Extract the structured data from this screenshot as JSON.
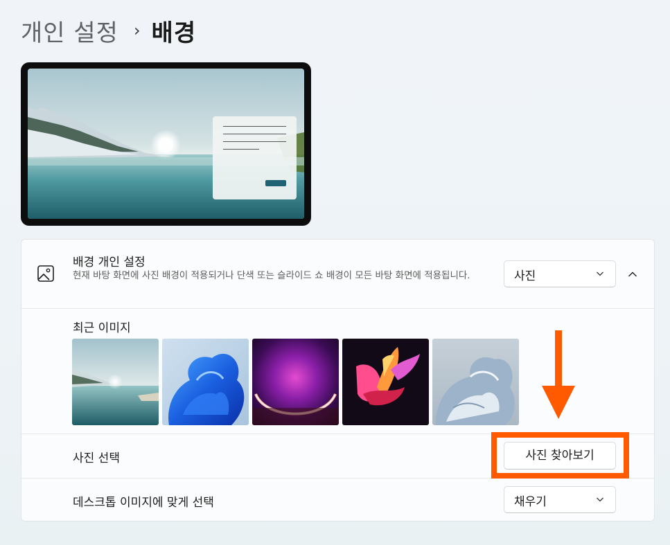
{
  "breadcrumb": {
    "parent": "개인 설정",
    "separator": "›",
    "current": "배경"
  },
  "background_section": {
    "icon": "image-icon",
    "title": "배경 개인 설정",
    "description": "현재 바탕 화면에 사진 배경이 적용되거나 단색 또는 슬라이드 쇼 배경이 모든 바탕 화면에 적용됩니다.",
    "type_selected": "사진",
    "collapse_icon": "chevron-up-icon"
  },
  "recent_images": {
    "title": "최근 이미지",
    "items": [
      {
        "name": "lake-landscape"
      },
      {
        "name": "blue-bloom"
      },
      {
        "name": "purple-glow"
      },
      {
        "name": "colorful-ribbons"
      },
      {
        "name": "silver-bloom"
      }
    ]
  },
  "choose_photo": {
    "label": "사진 선택",
    "button_label": "사진 찾아보기"
  },
  "fit": {
    "label": "데스크톱 이미지에 맞게 선택",
    "selected": "채우기"
  },
  "colors": {
    "highlight": "#ff5a00",
    "arrow": "#ff5a00"
  }
}
